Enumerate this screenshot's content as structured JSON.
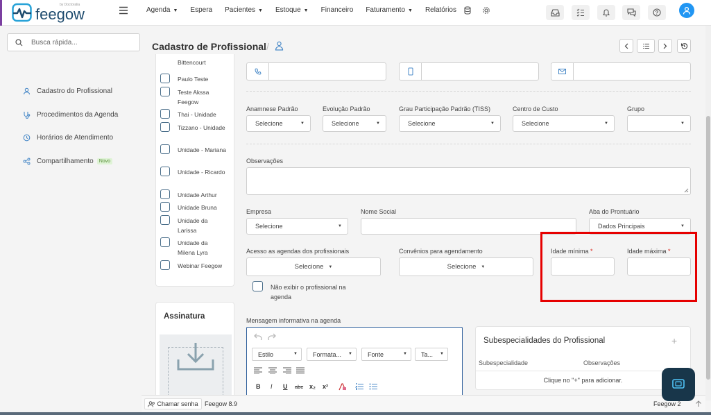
{
  "nav": {
    "brand": "feegow",
    "brand_by": "by Doctoralia",
    "menu": [
      "Agenda",
      "Espera",
      "Pacientes",
      "Estoque",
      "Financeiro",
      "Faturamento",
      "Relatórios"
    ],
    "menu_dropdown": [
      true,
      false,
      true,
      true,
      false,
      true,
      false
    ]
  },
  "search": {
    "placeholder": "Busca rápida..."
  },
  "sidebar": {
    "items": [
      {
        "label": "Cadastro do Profissional",
        "icon": "user-icon"
      },
      {
        "label": "Procedimentos da Agenda",
        "icon": "stethoscope-icon"
      },
      {
        "label": "Horários de Atendimento",
        "icon": "clock-icon"
      },
      {
        "label": "Compartilhamento",
        "icon": "share-icon",
        "badge": "Novo"
      }
    ]
  },
  "page": {
    "title": "Cadastro de Profissional",
    "separator": "/"
  },
  "units": [
    {
      "label": "Bittencourt",
      "checked": false
    },
    {
      "label": "Paulo Teste",
      "checked": false
    },
    {
      "label": "Teste Akssa Feegow",
      "checked": false
    },
    {
      "label": "Thai - Unidade",
      "checked": false
    },
    {
      "label": "Tizzano - Unidade",
      "checked": false
    },
    {
      "label": "Unidade - Mariana",
      "checked": false
    },
    {
      "label": "Unidade - Ricardo",
      "checked": false
    },
    {
      "label": "Unidade Arthur",
      "checked": false
    },
    {
      "label": "Unidade Bruna",
      "checked": false
    },
    {
      "label": "Unidade da Larissa",
      "checked": false
    },
    {
      "label": "Unidade da Milena Lyra",
      "checked": false
    },
    {
      "label": "Webinar Feegow",
      "checked": false
    }
  ],
  "signature": {
    "title": "Assinatura"
  },
  "form": {
    "contact": {
      "phone": "",
      "mobile": "",
      "email": ""
    },
    "row1": {
      "anamnese": {
        "label": "Anamnese Padrão",
        "value": "Selecione"
      },
      "evolucao": {
        "label": "Evolução Padrão",
        "value": "Selecione"
      },
      "grau": {
        "label": "Grau Participação Padrão (TISS)",
        "value": "Selecione"
      },
      "centro": {
        "label": "Centro de Custo",
        "value": "Selecione"
      },
      "grupo": {
        "label": "Grupo",
        "value": ""
      }
    },
    "observacoes": {
      "label": "Observações",
      "value": ""
    },
    "empresa": {
      "label": "Empresa",
      "value": "Selecione"
    },
    "nome_social": {
      "label": "Nome Social",
      "value": ""
    },
    "aba": {
      "label": "Aba do Prontuário",
      "value": "Dados Principais"
    },
    "acesso": {
      "label": "Acesso as agendas dos profissionais",
      "value": "Selecione"
    },
    "convenios": {
      "label": "Convênios para agendamento",
      "value": "Selecione"
    },
    "idade_min": {
      "label": "Idade mínima",
      "required": "*",
      "value": ""
    },
    "idade_max": {
      "label": "Idade máxima",
      "required": "*",
      "value": ""
    },
    "nao_exibir": {
      "label": "Não exibir o profissional na agenda",
      "checked": false
    },
    "mensagem": {
      "label": "Mensagem informativa na agenda"
    }
  },
  "editor": {
    "estilo": "Estilo",
    "formato": "Formata...",
    "fonte": "Fonte",
    "tamanho": "Ta...",
    "bold": "B",
    "italic": "I",
    "underline": "U",
    "strike": "abc",
    "subscript": "x₂",
    "superscript": "x²"
  },
  "subespecialidades": {
    "title": "Subespecialidades do Profissional",
    "add": "+",
    "col1": "Subespecialidade",
    "col2": "Observações",
    "empty": "Clique no \"+\" para adicionar."
  },
  "footer": {
    "chamar": "Chamar senha",
    "version": "Feegow 8.9",
    "right": "Feegow 2"
  },
  "colors": {
    "accent": "#2196f3",
    "brand": "#1e4b6e",
    "highlight": "#e60000",
    "required": "#d9261c"
  }
}
